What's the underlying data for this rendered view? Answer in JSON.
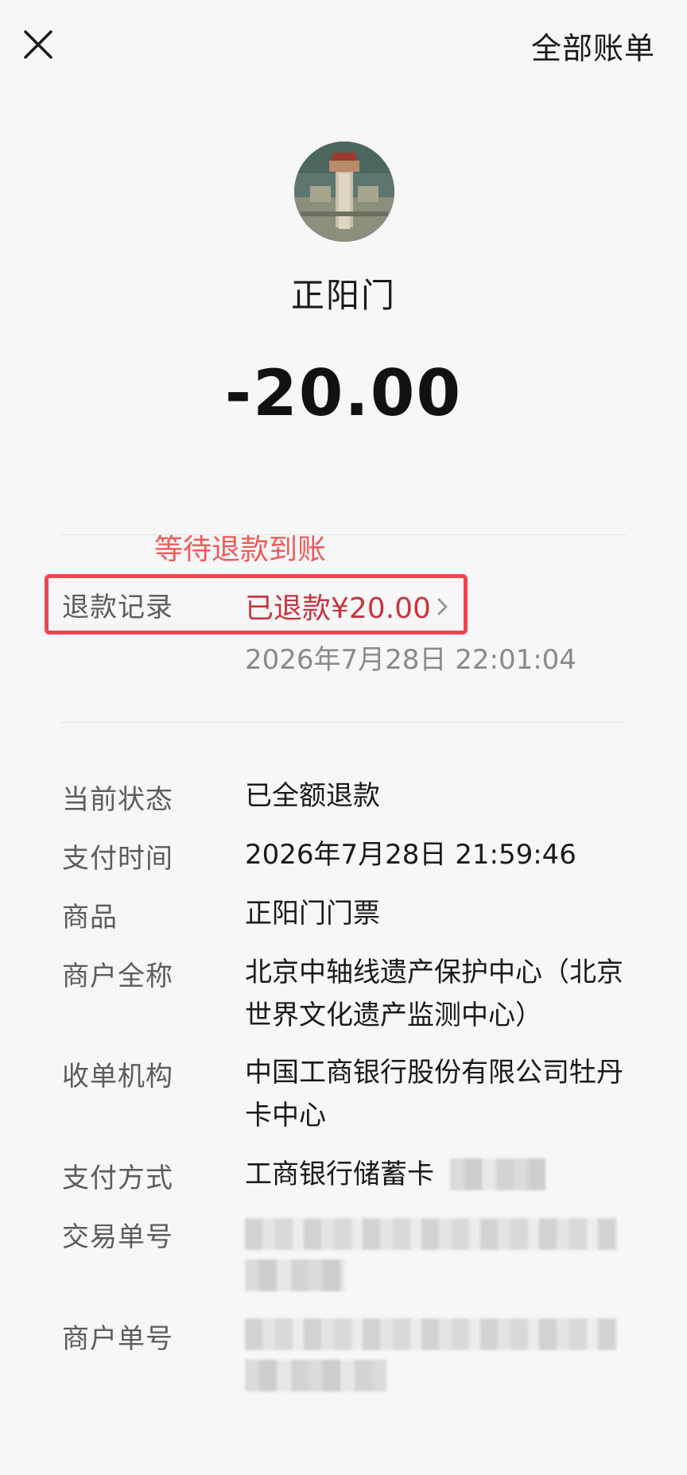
{
  "header": {
    "close_icon": "close-icon",
    "all_bills_label": "全部账单"
  },
  "merchant": {
    "avatar_icon": "zhengyangmen-avatar",
    "name": "正阳门"
  },
  "transaction": {
    "amount": "-20.00"
  },
  "refund": {
    "annotation": "等待退款到账",
    "label": "退款记录",
    "value": "已退款¥20.00",
    "time": "2026年7月28日 22:01:04",
    "highlight_color": "#f0444f"
  },
  "details": [
    {
      "label": "当前状态",
      "value": "已全额退款"
    },
    {
      "label": "支付时间",
      "value": "2026年7月28日 21:59:46"
    },
    {
      "label": "商品",
      "value": "正阳门门票"
    },
    {
      "label": "商户全称",
      "value": "北京中轴线遗产保护中心（北京世界文化遗产监测中心）"
    },
    {
      "label": "收单机构",
      "value": "中国工商银行股份有限公司牡丹卡中心"
    },
    {
      "label": "支付方式",
      "value": "工商银行储蓄卡"
    },
    {
      "label": "交易单号",
      "value": ""
    },
    {
      "label": "商户单号",
      "value": ""
    }
  ],
  "colors": {
    "background": "#f7f7f7",
    "refund_red": "#c7343f",
    "annotation_red": "#f05a5a",
    "label_gray": "#5c5c5c"
  }
}
